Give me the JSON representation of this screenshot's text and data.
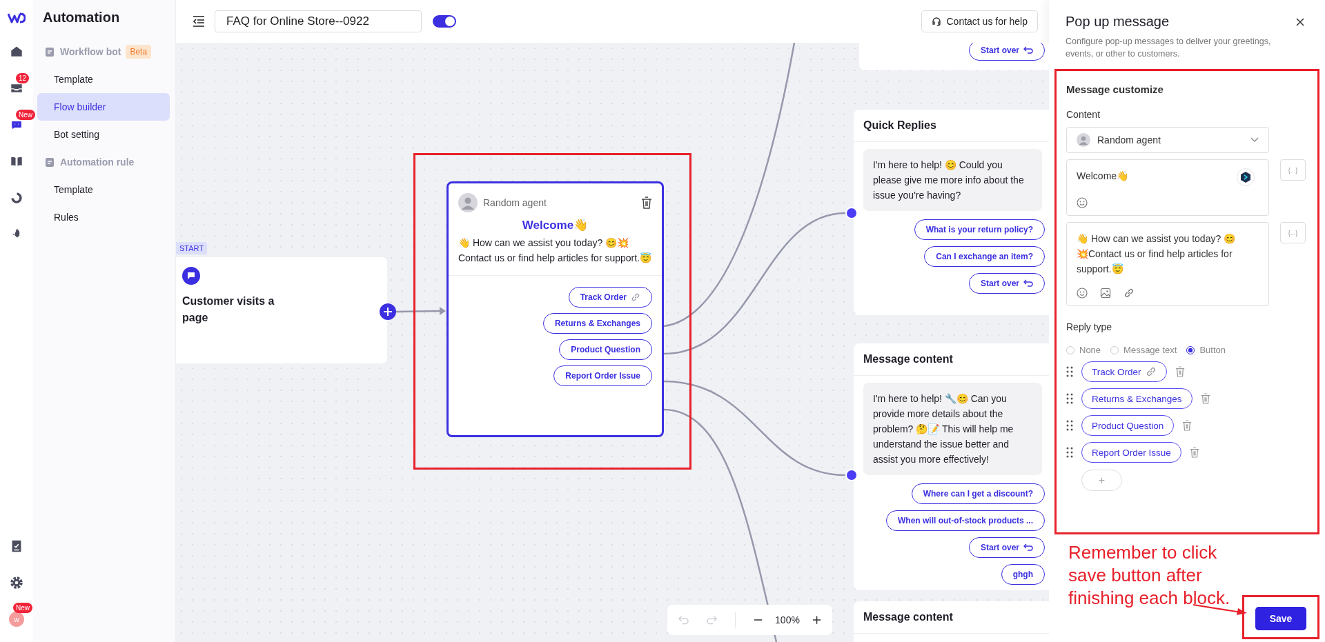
{
  "rail": {
    "items": [
      {
        "selected": false
      },
      {
        "selected": false,
        "badge": "12"
      },
      {
        "selected": true,
        "badge": "New"
      },
      {
        "selected": false
      },
      {
        "selected": false
      },
      {
        "selected": false
      }
    ],
    "bottom_items": [
      {
        "selected": false
      },
      {
        "selected": false
      }
    ],
    "avatar": {
      "initial": "w",
      "badge": "New"
    }
  },
  "nav": {
    "title": "Automation",
    "groups": [
      {
        "label": "Workflow bot",
        "badge": "Beta",
        "items": [
          {
            "label": "Template",
            "selected": false
          },
          {
            "label": "Flow builder",
            "selected": true
          },
          {
            "label": "Bot setting",
            "selected": false
          }
        ]
      },
      {
        "label": "Automation rule",
        "items": [
          {
            "label": "Template",
            "selected": false
          },
          {
            "label": "Rules",
            "selected": false
          }
        ]
      }
    ]
  },
  "topbar": {
    "flow_name": "FAQ for Online Store--0922",
    "enabled": true,
    "help_button": "Contact us for help"
  },
  "canvas": {
    "start_node": {
      "tag": "START",
      "title": "Customer visits a page"
    },
    "selected_card": {
      "agent": "Random agent",
      "heading": "Welcome👋",
      "message": "👋 How can we assist you today? 😊💥 Contact us or find help articles for support.😇",
      "buttons": [
        {
          "label": "Track Order",
          "kind": "link"
        },
        {
          "label": "Returns & Exchanges",
          "kind": "plain"
        },
        {
          "label": "Product Question",
          "kind": "plain"
        },
        {
          "label": "Report Order Issue",
          "kind": "plain"
        }
      ]
    },
    "top_node": {
      "buttons": [
        {
          "label": "Start over",
          "kind": "restart"
        }
      ]
    },
    "nodes": [
      {
        "title": "Quick Replies",
        "message": "I'm here to help! 😊 Could you please give me more info about the issue you're having?",
        "buttons": [
          {
            "label": "What is your return policy?",
            "kind": "plain"
          },
          {
            "label": "Can I exchange an item?",
            "kind": "plain"
          },
          {
            "label": "Start over",
            "kind": "restart"
          }
        ]
      },
      {
        "title": "Message content",
        "message": "I'm here to help! 🔧😊 Can you provide more details about the problem? 🤔📝 This will help me understand the issue better and assist you more effectively!",
        "buttons": [
          {
            "label": "Where can I get a discount?",
            "kind": "plain"
          },
          {
            "label": "When will out-of-stock products ...",
            "kind": "plain"
          },
          {
            "label": "Start over",
            "kind": "restart"
          },
          {
            "label": "ghgh",
            "kind": "plain"
          }
        ]
      },
      {
        "title": "Message content"
      }
    ],
    "zoom_control": {
      "undo_enabled": false,
      "redo_enabled": false,
      "zoom": "100%"
    }
  },
  "panel": {
    "title": "Pop up message",
    "description": "Configure pop-up messages to deliver your greetings, events, or other to customers.",
    "section": "Message customize",
    "content_label": "Content",
    "agent": "Random agent",
    "fields": [
      {
        "kind": "greeting",
        "value": "Welcome👋",
        "variable": "{...}"
      },
      {
        "kind": "message",
        "value": "👋 How can we assist you today? 😊 💥Contact us or find help articles for support.😇",
        "variable": "{...}"
      }
    ],
    "reply_type_label": "Reply type",
    "reply_types": [
      {
        "label": "None",
        "selected": false
      },
      {
        "label": "Message text",
        "selected": false
      },
      {
        "label": "Button",
        "selected": true
      }
    ],
    "buttons": [
      {
        "label": "Track Order",
        "kind": "link"
      },
      {
        "label": "Returns & Exchanges",
        "kind": "plain"
      },
      {
        "label": "Product Question",
        "kind": "plain"
      },
      {
        "label": "Report Order Issue",
        "kind": "plain"
      }
    ],
    "add_button": "+",
    "annotation": "Remember to click save button after finishing each block.",
    "save_button": "Save"
  }
}
